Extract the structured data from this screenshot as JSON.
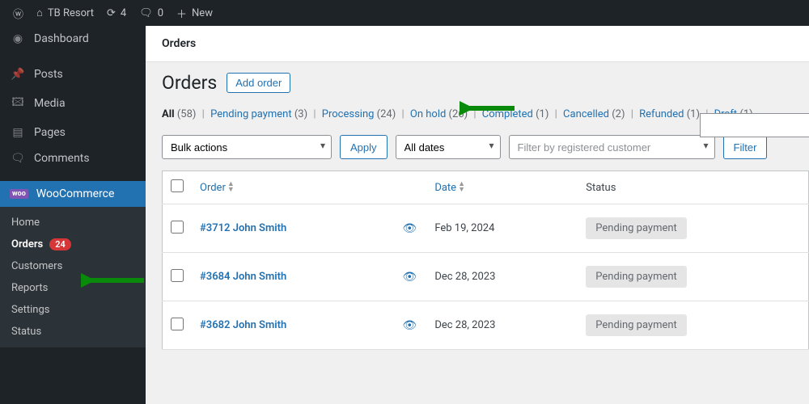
{
  "topbar": {
    "site_name": "TB Resort",
    "updates_count": "4",
    "comments_count": "0",
    "new_label": "New"
  },
  "sidebar": {
    "items": [
      {
        "label": "Dashboard",
        "icon": "◷"
      },
      {
        "label": "Posts",
        "icon": "✎"
      },
      {
        "label": "Media",
        "icon": "🖾"
      },
      {
        "label": "Pages",
        "icon": "❐"
      },
      {
        "label": "Comments",
        "icon": "💬"
      },
      {
        "label": "WooCommerce",
        "icon": "woo",
        "active": true
      }
    ],
    "sub": [
      {
        "label": "Home"
      },
      {
        "label": "Orders",
        "badge": "24",
        "current": true
      },
      {
        "label": "Customers"
      },
      {
        "label": "Reports"
      },
      {
        "label": "Settings"
      },
      {
        "label": "Status"
      }
    ]
  },
  "breadcrumb": "Orders",
  "page": {
    "title": "Orders",
    "add_button": "Add order"
  },
  "status_filters": [
    {
      "label": "All",
      "count": "58",
      "bold": true
    },
    {
      "label": "Pending payment",
      "count": "3"
    },
    {
      "label": "Processing",
      "count": "24"
    },
    {
      "label": "On hold",
      "count": "26"
    },
    {
      "label": "Completed",
      "count": "1"
    },
    {
      "label": "Cancelled",
      "count": "2"
    },
    {
      "label": "Refunded",
      "count": "1"
    },
    {
      "label": "Draft",
      "count": "1"
    }
  ],
  "toolbar": {
    "bulk_label": "Bulk actions",
    "apply_label": "Apply",
    "dates_label": "All dates",
    "customer_placeholder": "Filter by registered customer",
    "filter_label": "Filter"
  },
  "table": {
    "cols": {
      "order": "Order",
      "date": "Date",
      "status": "Status"
    },
    "rows": [
      {
        "order": "#3712 John Smith",
        "date": "Feb 19, 2024",
        "status": "Pending payment"
      },
      {
        "order": "#3684 John Smith",
        "date": "Dec 28, 2023",
        "status": "Pending payment"
      },
      {
        "order": "#3682 John Smith",
        "date": "Dec 28, 2023",
        "status": "Pending payment"
      }
    ]
  }
}
